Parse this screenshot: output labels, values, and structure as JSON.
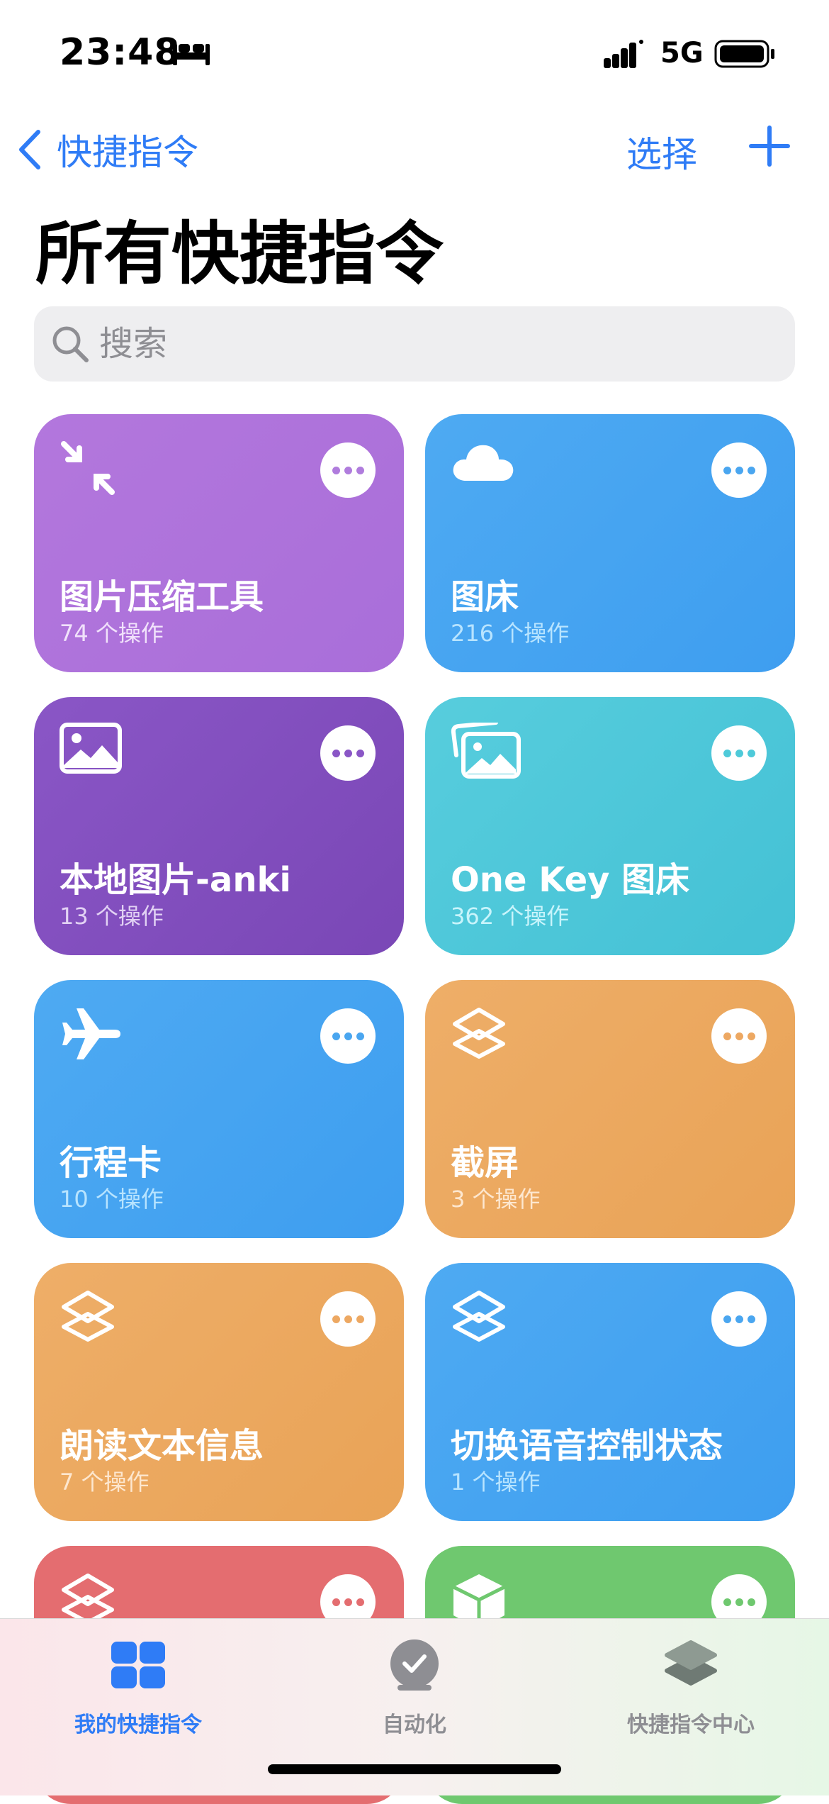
{
  "status": {
    "time": "23:48",
    "network": "5G"
  },
  "nav": {
    "back_label": "快捷指令",
    "select_label": "选择"
  },
  "page_title": "所有快捷指令",
  "search": {
    "placeholder": "搜索"
  },
  "shortcuts": [
    {
      "title": "图片压缩工具",
      "subtitle": "74 个操作",
      "icon": "compress-arrows-icon",
      "bg": "#b377dd",
      "bg2": "#a96ed9",
      "accent": "#b07cdd",
      "subcolor": "#f1e2fb"
    },
    {
      "title": "图床",
      "subtitle": "216 个操作",
      "icon": "cloud-icon",
      "bg": "#4eaaf2",
      "bg2": "#3e9ef0",
      "accent": "#4aa6f0",
      "subcolor": "#b8e4ff"
    },
    {
      "title": "本地图片-anki",
      "subtitle": "13 个操作",
      "icon": "photo-icon",
      "bg": "#8a56c6",
      "bg2": "#7a47b6",
      "accent": "#8a56c6",
      "subcolor": "#e2d2f4"
    },
    {
      "title": "One Key 图床",
      "subtitle": "362 个操作",
      "icon": "photos-stack-icon",
      "bg": "#57cddd",
      "bg2": "#44c1d5",
      "accent": "#4ecad9",
      "subcolor": "#c8f4fb"
    },
    {
      "title": "行程卡",
      "subtitle": "10 个操作",
      "icon": "airplane-icon",
      "bg": "#4eaaf2",
      "bg2": "#3e9ef0",
      "accent": "#4aa6f0",
      "subcolor": "#b8e4ff"
    },
    {
      "title": "截屏",
      "subtitle": "3 个操作",
      "icon": "layers-icon",
      "bg": "#eeae68",
      "bg2": "#e9a357",
      "accent": "#eda862",
      "subcolor": "#fde7cf"
    },
    {
      "title": "朗读文本信息",
      "subtitle": "7 个操作",
      "icon": "layers-icon",
      "bg": "#eeae68",
      "bg2": "#e9a357",
      "accent": "#eda862",
      "subcolor": "#fde7cf"
    },
    {
      "title": "切换语音控制状态",
      "subtitle": "1 个操作",
      "icon": "layers-icon",
      "bg": "#4eaaf2",
      "bg2": "#3e9ef0",
      "accent": "#4aa6f0",
      "subcolor": "#b8e4ff"
    },
    {
      "title": "",
      "subtitle": "",
      "icon": "layers-icon",
      "bg": "#e46d70",
      "bg2": "#e46d70",
      "accent": "#e46d70",
      "subcolor": "#ffd9da"
    },
    {
      "title": "",
      "subtitle": "",
      "icon": "cube-icon",
      "bg": "#6fc86f",
      "bg2": "#6fc86f",
      "accent": "#6fc86f",
      "subcolor": "#d9f5d9"
    }
  ],
  "tabs": [
    {
      "label": "我的快捷指令",
      "icon": "grid-icon",
      "color": "#2f7cf6",
      "active": true
    },
    {
      "label": "自动化",
      "icon": "clock-check-icon",
      "color": "#8e8e93",
      "active": false
    },
    {
      "label": "快捷指令中心",
      "icon": "layers-icon",
      "color": "#8e8e93",
      "active": false
    }
  ],
  "colors": {
    "accent": "#2f7cf6"
  }
}
